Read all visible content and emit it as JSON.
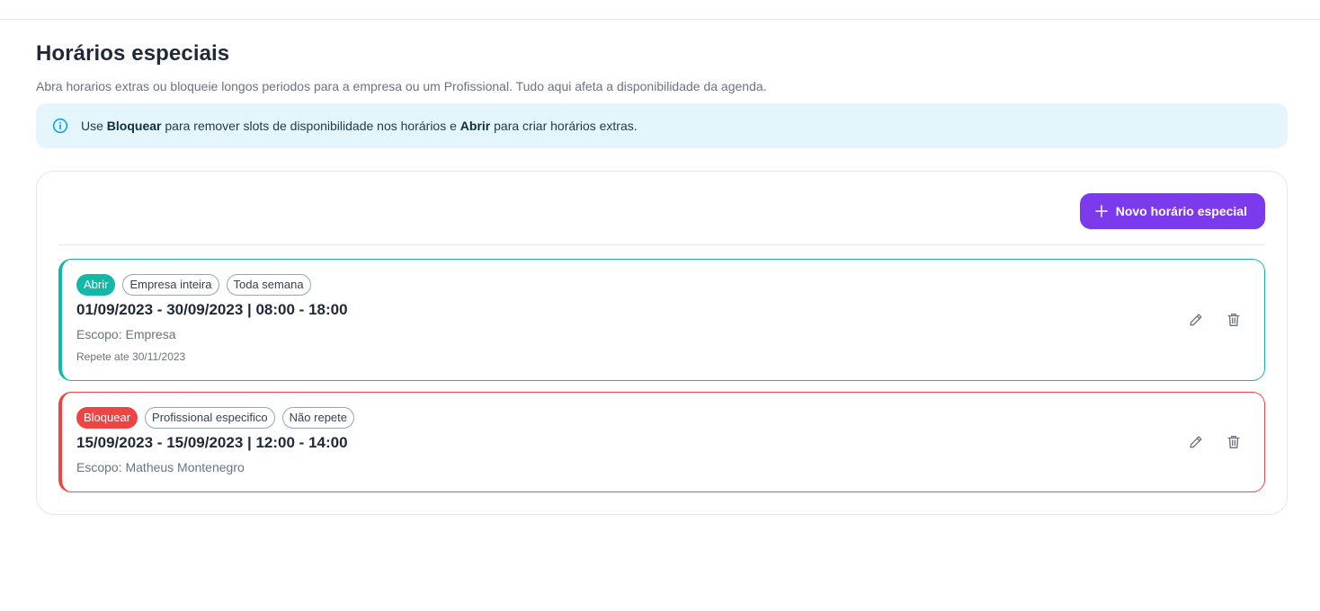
{
  "page": {
    "title": "Horários especiais",
    "subtitle": "Abra horarios extras ou bloqueie longos periodos para a empresa ou um Profissional. Tudo aqui afeta a disponibilidade da agenda."
  },
  "info": {
    "icon": "info-icon",
    "text_prefix": "Use ",
    "bold_block": "Bloquear",
    "text_middle": " para remover slots de disponibilidade nos horários e ",
    "bold_open": "Abrir",
    "text_suffix": " para criar horários extras."
  },
  "toolbar": {
    "new_label": "Novo horário especial",
    "new_icon": "plus-icon"
  },
  "colors": {
    "accent": "#7c3aed",
    "open": "#14b8a6",
    "block": "#ef4444",
    "info_bg": "#e4f6fb",
    "info_icon": "#0ea5e9"
  },
  "items": [
    {
      "type_label": "Abrir",
      "scope_tag": "Empresa inteira",
      "repeat_tag": "Toda semana",
      "title": "01/09/2023 - 30/09/2023 | 08:00 - 18:00",
      "scope": "Escopo: Empresa",
      "repeat": "Repete ate 30/11/2023"
    },
    {
      "type_label": "Bloquear",
      "scope_tag": "Profissional especifico",
      "repeat_tag": "Não repete",
      "title": "15/09/2023 - 15/09/2023 | 12:00 - 14:00",
      "scope": "Escopo: Matheus Montenegro"
    }
  ]
}
